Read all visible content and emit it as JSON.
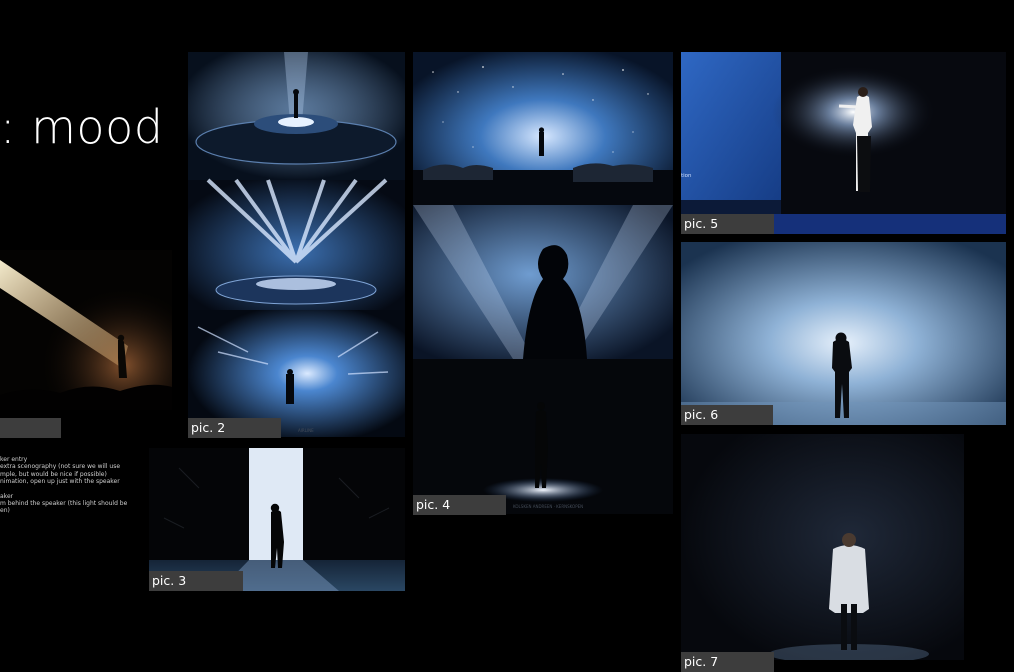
{
  "title": ": mood",
  "notes": [
    "ker entry",
    "extra scenography (not sure we will use",
    "mple, but would be nice if possible)",
    "nimation, open up just with the speaker",
    "",
    "aker",
    "m behind the speaker (this light should be",
    "en)"
  ],
  "labels": {
    "pic1": "",
    "pic2": "pic. 2",
    "pic3": "pic. 3",
    "pic4": "pic. 4",
    "pic5": "pic. 5",
    "pic6": "pic. 6",
    "pic7": "pic. 7"
  },
  "screen_text": "tion",
  "colors": {
    "background": "#000000",
    "label_bg": "#3d3d3d",
    "stage_blue": "#2a5ea8",
    "warm_spot": "#f2e3b8"
  }
}
